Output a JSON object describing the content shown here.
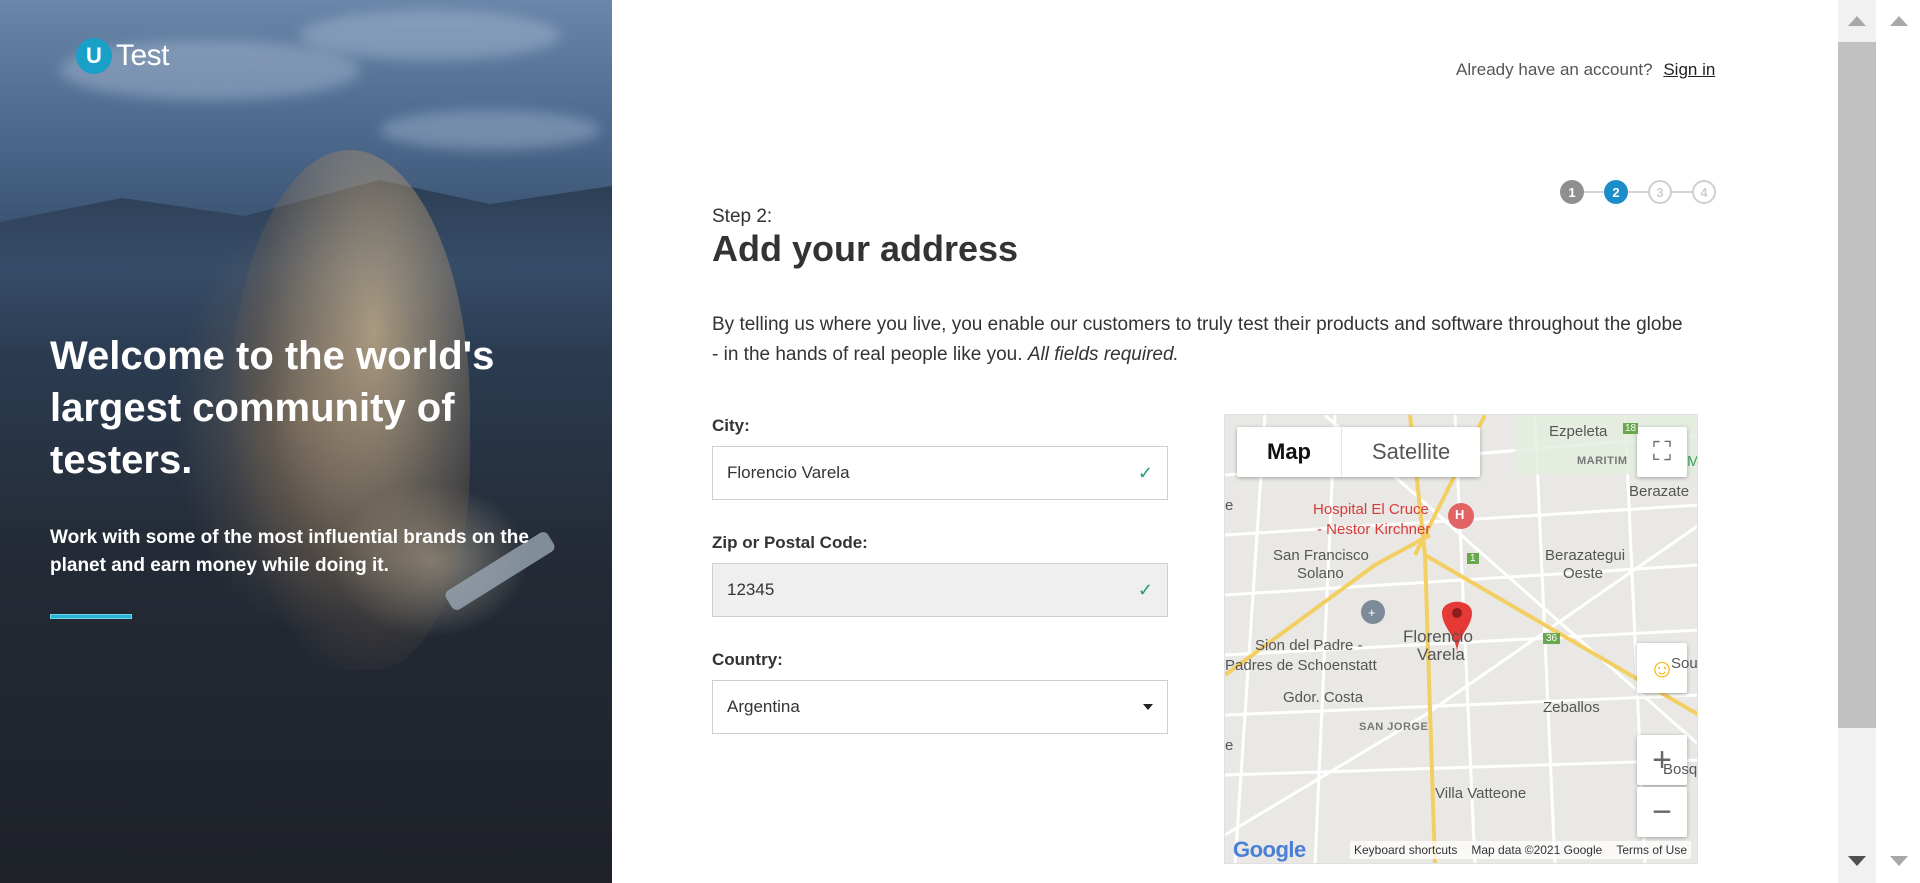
{
  "hero": {
    "logo_mark": "U",
    "logo_text": "Test",
    "title": "Welcome to the world's largest community of testers.",
    "subtitle": "Work with some of the most influential brands on the planet and earn money while doing it."
  },
  "header": {
    "prompt": "Already have an account?",
    "sign_in": "Sign in"
  },
  "steps": {
    "items": [
      "1",
      "2",
      "3",
      "4"
    ],
    "current": 2
  },
  "form": {
    "step_label": "Step 2:",
    "title": "Add your address",
    "intro": "By telling us where you live, you enable our customers to truly test their products and software throughout the globe - in the hands of real people like you.",
    "intro_note": "All fields required.",
    "city": {
      "label": "City:",
      "value": "Florencio Varela"
    },
    "zip": {
      "label": "Zip or Postal Code:",
      "value": "12345"
    },
    "country": {
      "label": "Country:",
      "value": "Argentina"
    }
  },
  "map": {
    "toggle_map": "Map",
    "toggle_satellite": "Satellite",
    "places": {
      "ezpeleta": "Ezpeleta",
      "maritim": "MARITIM",
      "berazate": "Berazate",
      "hospital_1": "Hospital El Cruce",
      "hospital_2": "- Nestor Kirchner",
      "san_francisco_1": "San Francisco",
      "san_francisco_2": "Solano",
      "berazategui_1": "Berazategui",
      "berazategui_2": "Oeste",
      "sion_1": "Sion del Padre -",
      "sion_2": "Padres de Schoenstatt",
      "florencio_1": "Florencio",
      "florencio_2": "Varela",
      "sou": "Sou",
      "gdor_costa": "Gdor. Costa",
      "zeballos": "Zeballos",
      "san_jorge": "SAN JORGE",
      "bosq": "Bosq",
      "villa_vatteone": "Villa Vatteone",
      "edge_e1": "e",
      "edge_e2": "e",
      "road_18": "18",
      "road_1": "1",
      "road_36": "36",
      "hospital_icon": "H",
      "m_edge": "M"
    },
    "google": "Google",
    "footer": {
      "shortcuts": "Keyboard shortcuts",
      "map_data": "Map data ©2021 Google",
      "terms": "Terms of Use"
    }
  },
  "colors": {
    "accent": "#1b8ec9",
    "logo": "#18a0c8",
    "check": "#1fa36b",
    "pin": "#e53935"
  }
}
